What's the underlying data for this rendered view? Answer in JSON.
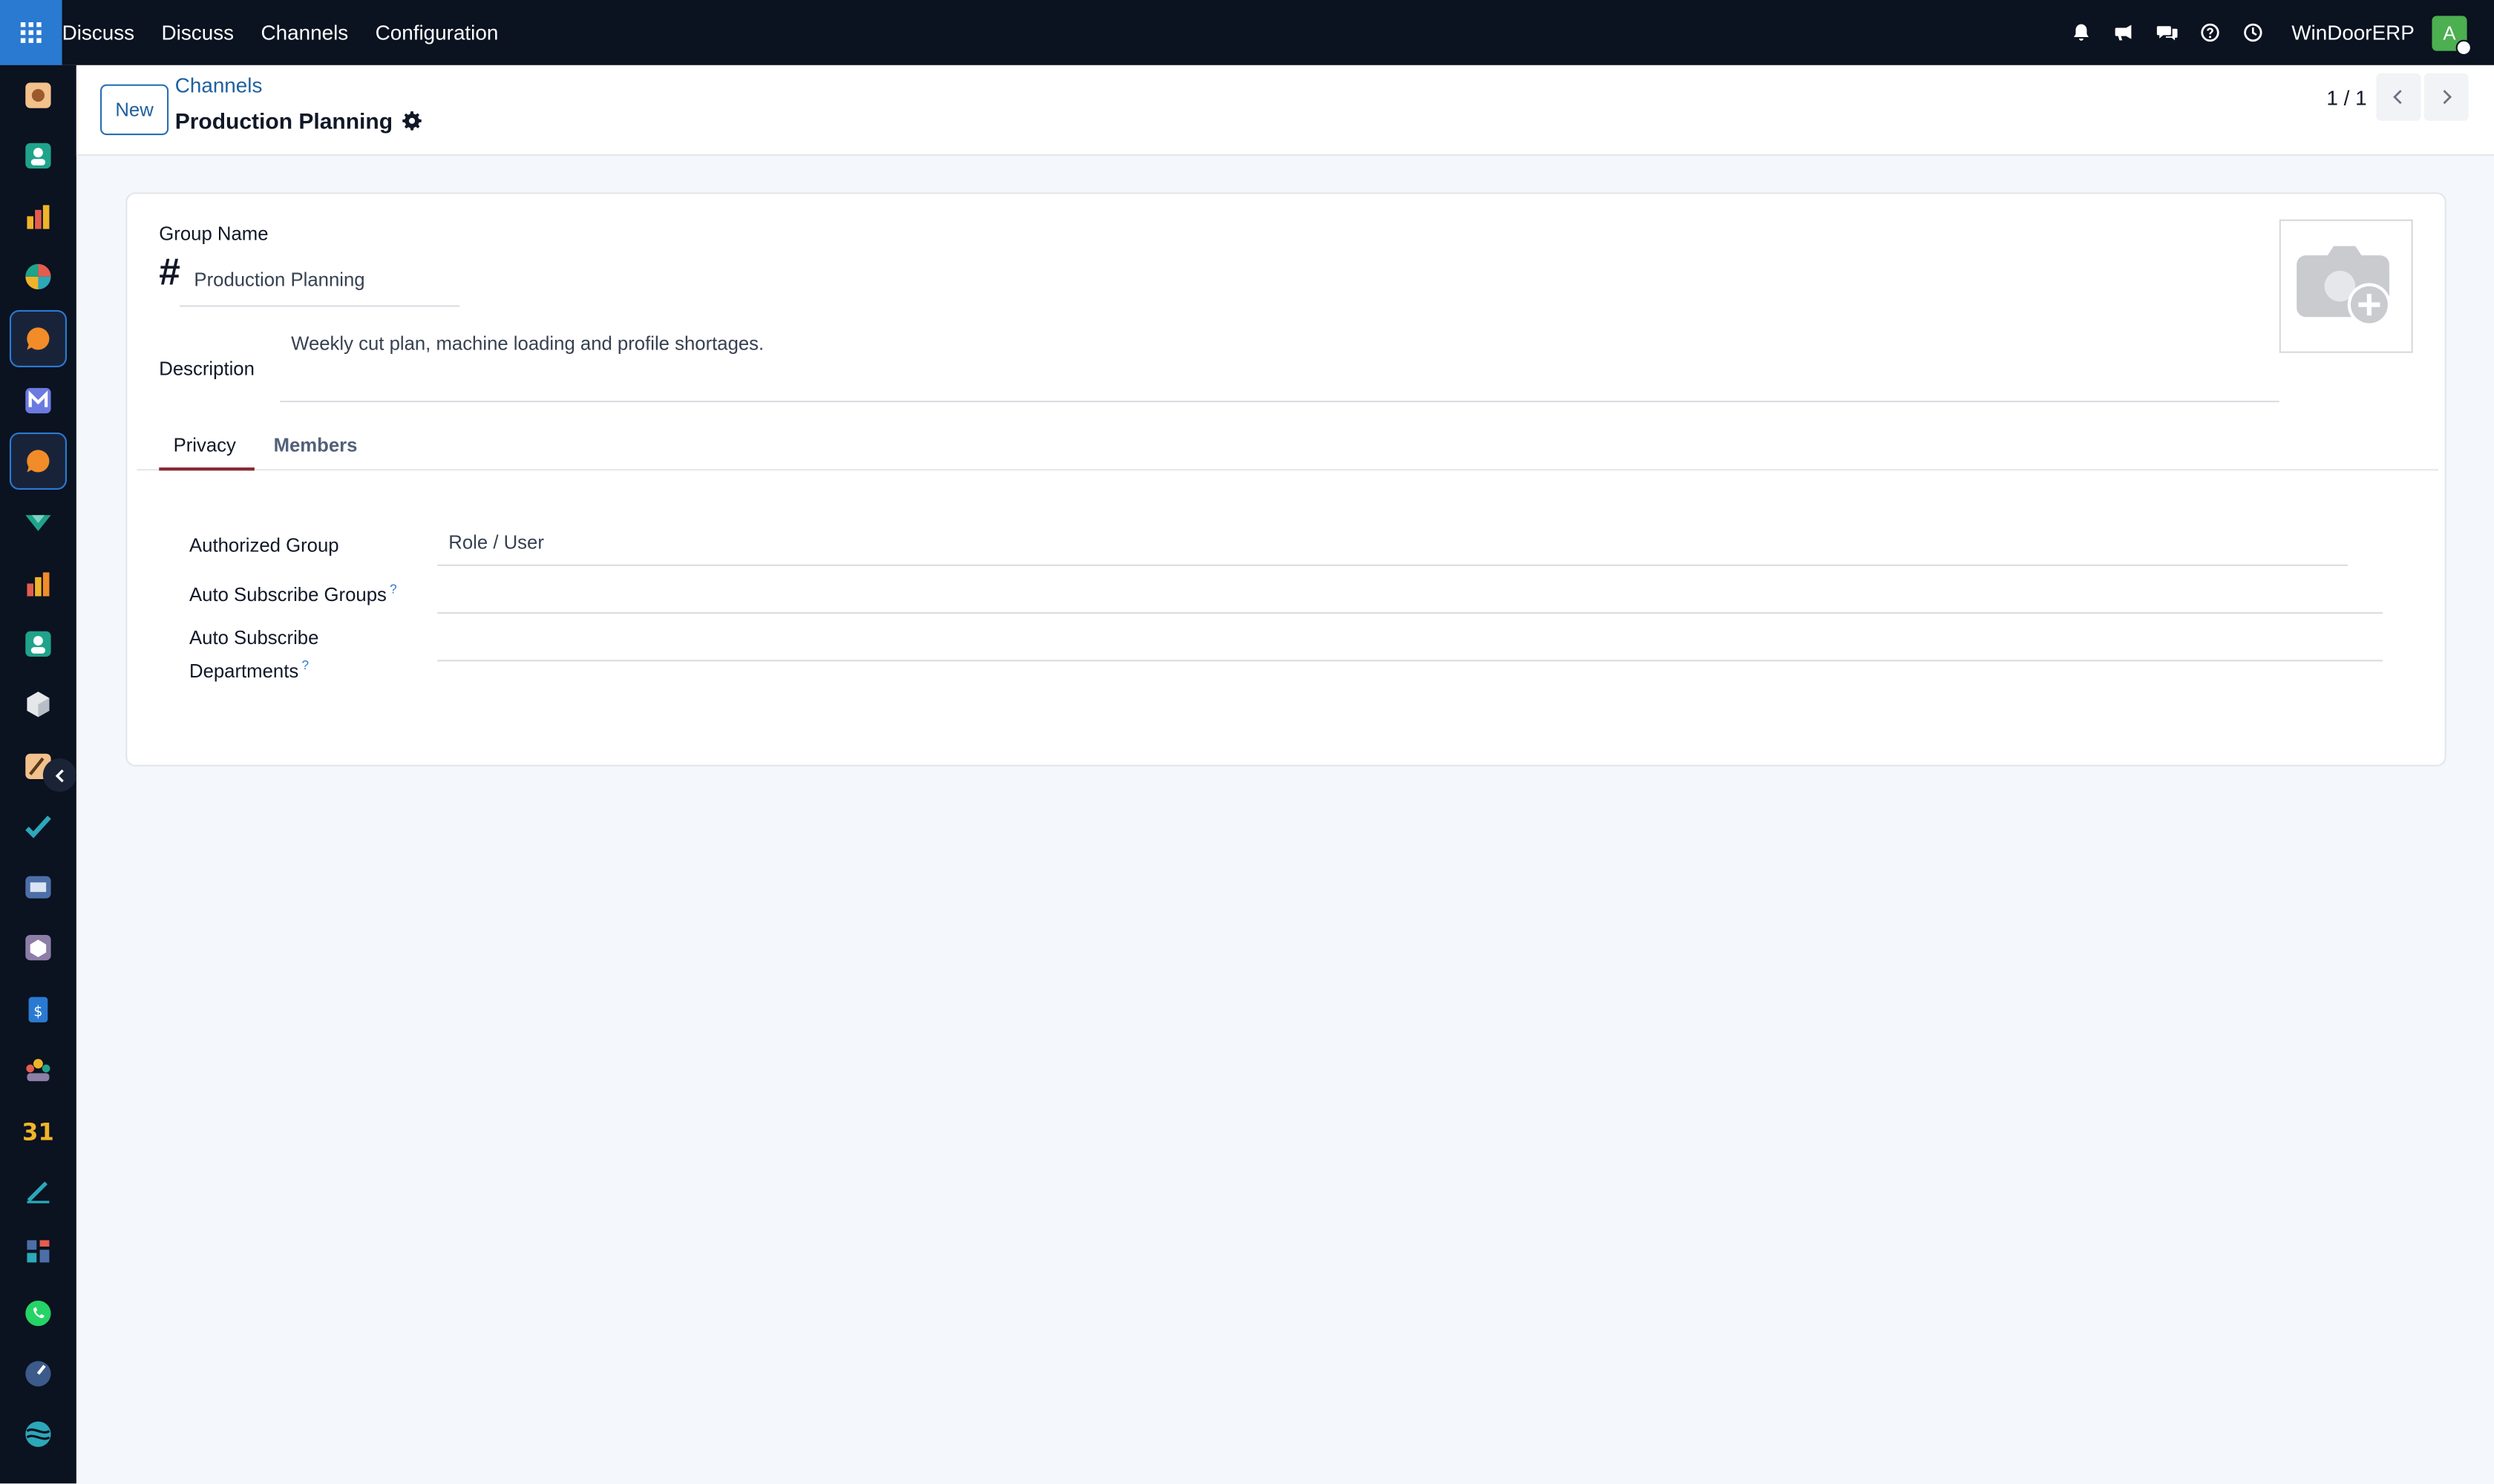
{
  "topbar": {
    "nav": [
      "Discuss",
      "Discuss",
      "Channels",
      "Configuration"
    ],
    "company": "WinDoorERP",
    "avatar_initial": "A",
    "icons": [
      "bell-icon",
      "megaphone-icon",
      "chat-icon",
      "help-icon",
      "clock-icon"
    ]
  },
  "sidebar": {
    "items": [
      "dashboard-app-icon",
      "contacts-app-icon",
      "reports-app-icon",
      "analytics-app-icon",
      "discuss-app-icon",
      "mail-app-icon",
      "discuss-app-icon-active",
      "inventory-app-icon",
      "sales-app-icon",
      "employees-app-icon",
      "product-app-icon",
      "settings-app-icon",
      "tasks-app-icon",
      "knowledge-app-icon",
      "packages-app-icon",
      "invoicing-app-icon",
      "team-app-icon",
      "calendar-app-icon",
      "sign-app-icon",
      "dashboard-grid-app-icon",
      "whatsapp-app-icon",
      "time-app-icon",
      "website-app-icon"
    ]
  },
  "control": {
    "new_label": "New",
    "breadcrumb": "Channels",
    "title": "Production Planning",
    "pager": "1 / 1"
  },
  "form": {
    "group_name_label": "Group Name",
    "hash": "#",
    "group_name_value": "Production Planning",
    "description_label": "Description",
    "description_value": "Weekly cut plan, machine loading and profile shortages.",
    "tabs": [
      "Privacy",
      "Members"
    ],
    "authorized_group_label": "Authorized Group",
    "authorized_group_value": "Role / User",
    "auto_subscribe_groups_label": "Auto Subscribe Groups",
    "auto_subscribe_departments_label_1": "Auto Subscribe",
    "auto_subscribe_departments_label_2": "Departments",
    "help_mark": "?"
  }
}
